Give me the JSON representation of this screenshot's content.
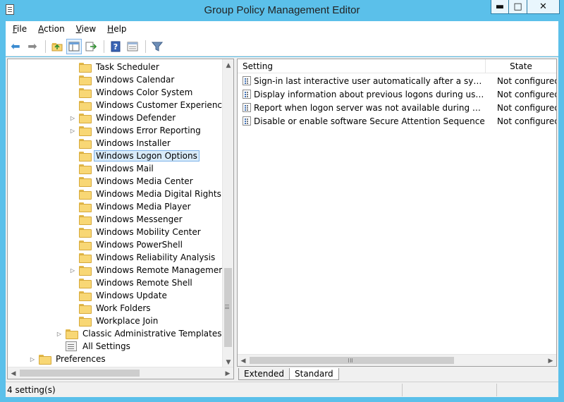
{
  "window": {
    "title": "Group Policy Management Editor"
  },
  "menu": {
    "items": [
      {
        "accel": "F",
        "rest": "ile"
      },
      {
        "accel": "A",
        "rest": "ction"
      },
      {
        "accel": "V",
        "rest": "iew"
      },
      {
        "accel": "H",
        "rest": "elp"
      }
    ]
  },
  "toolbar": {
    "icons": [
      "back-icon",
      "forward-icon",
      "up-folder-icon",
      "show-hide-tree-icon",
      "export-list-icon",
      "help-icon",
      "properties-icon",
      "filter-icon"
    ]
  },
  "tree": {
    "items": [
      {
        "label": "Task Scheduler",
        "expandable": false
      },
      {
        "label": "Windows Calendar",
        "expandable": false
      },
      {
        "label": "Windows Color System",
        "expandable": false
      },
      {
        "label": "Windows Customer Experience Imp",
        "expandable": false
      },
      {
        "label": "Windows Defender",
        "expandable": true
      },
      {
        "label": "Windows Error Reporting",
        "expandable": true
      },
      {
        "label": "Windows Installer",
        "expandable": false
      },
      {
        "label": "Windows Logon Options",
        "expandable": false,
        "selected": true
      },
      {
        "label": "Windows Mail",
        "expandable": false
      },
      {
        "label": "Windows Media Center",
        "expandable": false
      },
      {
        "label": "Windows Media Digital Rights Man",
        "expandable": false
      },
      {
        "label": "Windows Media Player",
        "expandable": false
      },
      {
        "label": "Windows Messenger",
        "expandable": false
      },
      {
        "label": "Windows Mobility Center",
        "expandable": false
      },
      {
        "label": "Windows PowerShell",
        "expandable": false
      },
      {
        "label": "Windows Reliability Analysis",
        "expandable": false
      },
      {
        "label": "Windows Remote Management (W",
        "expandable": true
      },
      {
        "label": "Windows Remote Shell",
        "expandable": false
      },
      {
        "label": "Windows Update",
        "expandable": false
      },
      {
        "label": "Work Folders",
        "expandable": false
      },
      {
        "label": "Workplace Join",
        "expandable": false
      },
      {
        "label": "Classic Administrative Templates (ADM",
        "expandable": true
      },
      {
        "label": "All Settings",
        "expandable": false
      },
      {
        "label": "Preferences",
        "expandable": true
      }
    ]
  },
  "list": {
    "columns": {
      "setting": "Setting",
      "state": "State"
    },
    "rows": [
      {
        "setting": "Sign-in last interactive user automatically after a system-init...",
        "state": "Not configured"
      },
      {
        "setting": "Display information about previous logons during user logon",
        "state": "Not configured"
      },
      {
        "setting": "Report when logon server was not available during user logon",
        "state": "Not configured"
      },
      {
        "setting": "Disable or enable software Secure Attention Sequence",
        "state": "Not configured"
      }
    ]
  },
  "tabs": {
    "extended": "Extended",
    "standard": "Standard"
  },
  "status": {
    "text": "4 setting(s)"
  },
  "colors": {
    "frame": "#5bc0ea",
    "selection": "#d9ebf9",
    "selection_border": "#7eb4ea"
  }
}
